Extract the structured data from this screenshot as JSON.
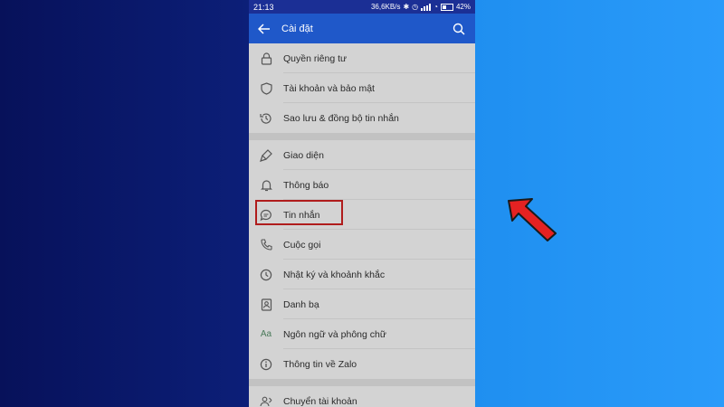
{
  "status_bar": {
    "time": "21:13",
    "speed": "36,6KB/s",
    "battery": "42%"
  },
  "app_bar": {
    "title": "Cài đặt",
    "back_icon": "arrow-left-icon",
    "search_icon": "search-icon"
  },
  "settings": {
    "group1": [
      {
        "label": "Quyền riêng tư",
        "icon": "lock-icon"
      },
      {
        "label": "Tài khoản và bảo mật",
        "icon": "shield-icon"
      },
      {
        "label": "Sao lưu & đồng bộ tin nhắn",
        "icon": "history-icon"
      }
    ],
    "group2": [
      {
        "label": "Giao diện",
        "icon": "brush-icon"
      },
      {
        "label": "Thông báo",
        "icon": "bell-icon"
      },
      {
        "label": "Tin nhắn",
        "icon": "chat-icon"
      },
      {
        "label": "Cuộc gọi",
        "icon": "phone-icon"
      },
      {
        "label": "Nhật ký và khoảnh khắc",
        "icon": "clock-icon"
      },
      {
        "label": "Danh bạ",
        "icon": "contacts-icon"
      },
      {
        "label": "Ngôn ngữ và phông chữ",
        "icon": "language-icon"
      },
      {
        "label": "Thông tin về Zalo",
        "icon": "info-icon"
      }
    ],
    "group3": [
      {
        "label": "Chuyển tài khoản",
        "icon": "switch-account-icon"
      }
    ]
  },
  "language_glyph": "Aa",
  "colors": {
    "app_bar": "#1f58c9",
    "status_bar": "#1b2f95",
    "highlight_border": "#b01c1c",
    "arrow": "#e52222",
    "bg_left": "#0a1a6b",
    "bg_right": "#2a9bfa"
  }
}
